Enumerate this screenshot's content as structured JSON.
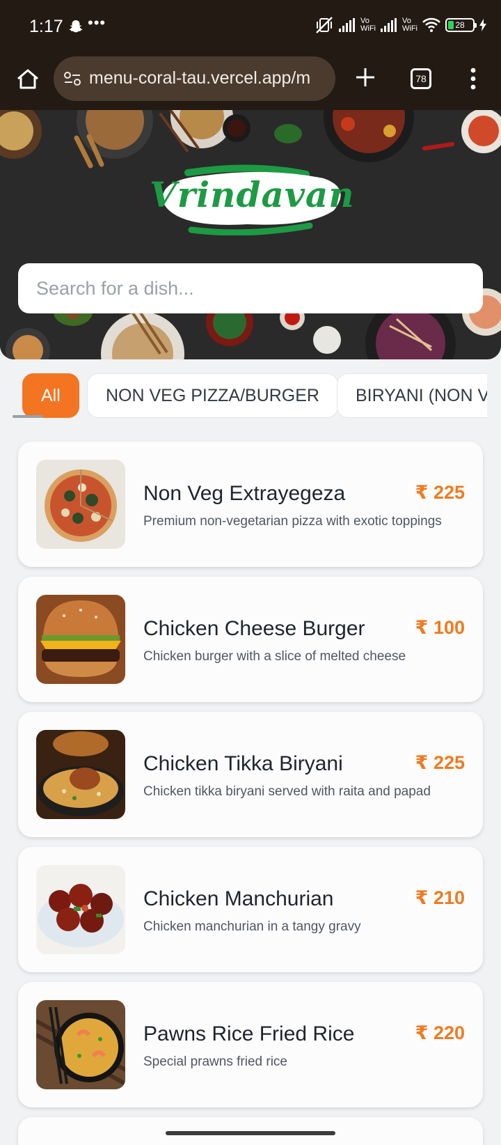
{
  "status_bar": {
    "time": "1:17",
    "battery_level": "28",
    "vowifi_label_1": "Vo\nWiFi",
    "vowifi_label_2": "Vo\nWiFi"
  },
  "browser": {
    "url": "menu-coral-tau.vercel.app/m",
    "tab_count": "78"
  },
  "hero": {
    "logo_text": "Vrindavan",
    "search_placeholder": "Search for a dish..."
  },
  "categories": [
    {
      "label": "All",
      "active": true
    },
    {
      "label": "NON VEG PIZZA/BURGER",
      "active": false
    },
    {
      "label": "BIRYANI (NON VI",
      "active": false
    }
  ],
  "menu_items": [
    {
      "name": "Non Veg Extrayegeza",
      "price": "₹ 225",
      "description": "Premium non-vegetarian pizza with exotic toppings",
      "image": "pizza"
    },
    {
      "name": "Chicken Cheese Burger",
      "price": "₹ 100",
      "description": "Chicken burger with a slice of melted cheese",
      "image": "burger"
    },
    {
      "name": "Chicken Tikka Biryani",
      "price": "₹ 225",
      "description": "Chicken tikka biryani served with raita and papad",
      "image": "biryani"
    },
    {
      "name": "Chicken Manchurian",
      "price": "₹ 210",
      "description": "Chicken manchurian in a tangy gravy",
      "image": "manchurian"
    },
    {
      "name": "Pawns Rice Fried Rice",
      "price": "₹ 220",
      "description": "Special prawns fried rice",
      "image": "fried-rice"
    }
  ],
  "colors": {
    "accent": "#f47521",
    "price": "#f07a1e",
    "chrome": "#231a14",
    "logo_green": "#1d9a44"
  }
}
